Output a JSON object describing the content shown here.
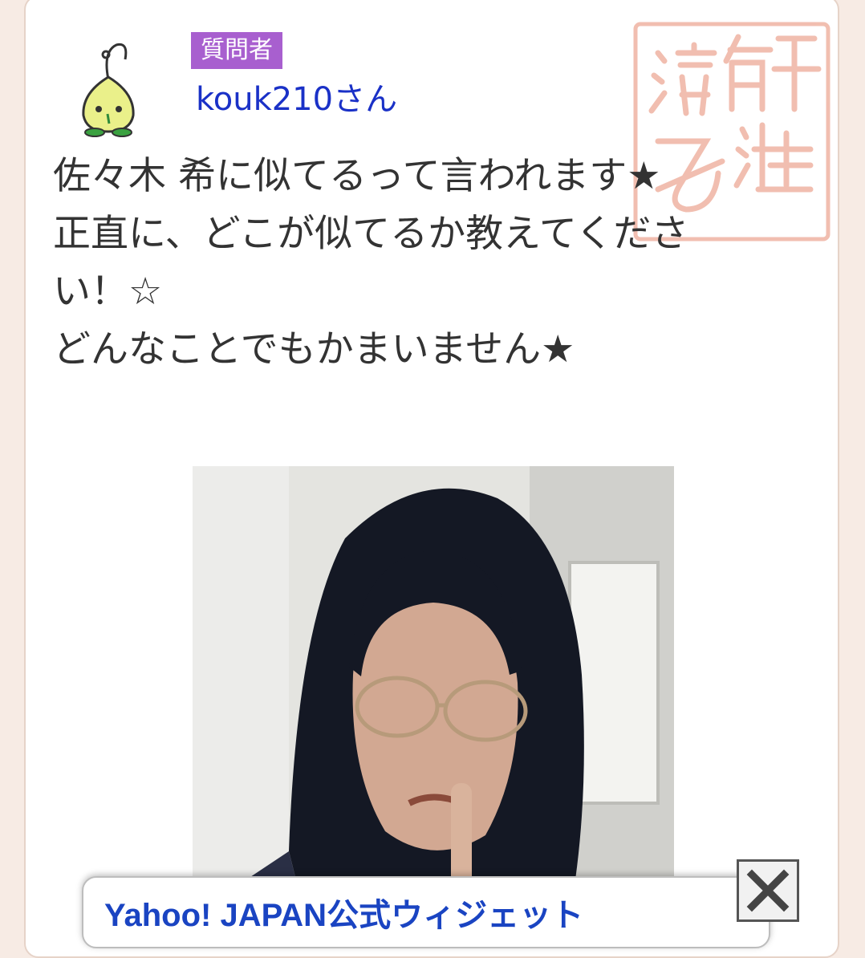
{
  "question": {
    "role_badge": "質問者",
    "username": "kouk210さん",
    "body": [
      "佐々木 希に似てるって言われます★",
      "",
      "正直に、どこが似てるか教えてくださ",
      "い！☆",
      "どんなことでもかまいません★"
    ],
    "stamp_text": "解決済み"
  },
  "widget": {
    "label": "Yahoo! JAPAN公式ウィジェット"
  },
  "icons": {
    "avatar": "sprout-mascot-icon",
    "stamp": "resolved-stamp-icon",
    "close": "close-icon"
  },
  "colors": {
    "page_bg": "#f7ebe4",
    "badge": "#a85fcf",
    "username": "#1a31c7",
    "body_text": "#333333",
    "stamp": "#f0b8a8",
    "widget_label": "#1a44c2"
  }
}
